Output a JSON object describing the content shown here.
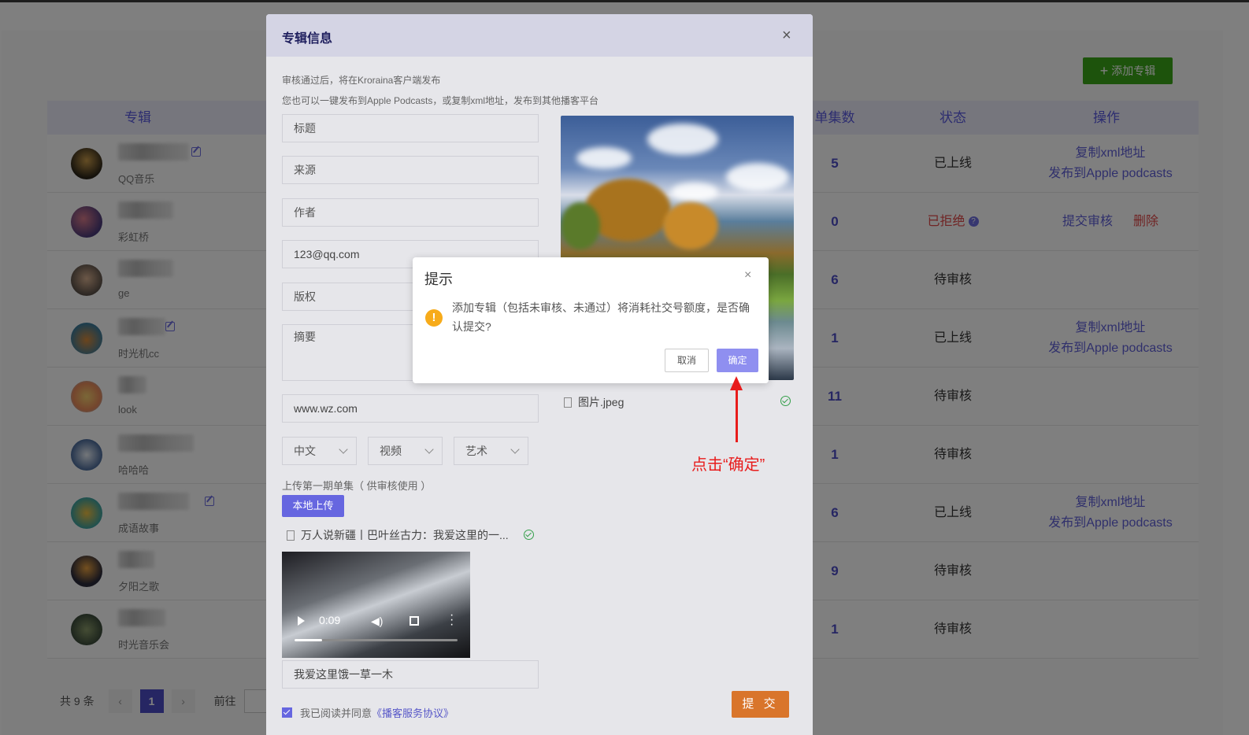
{
  "toolbar": {
    "add_album_label": "添加专辑"
  },
  "table": {
    "headers": {
      "album": "专辑",
      "episodes": "单集数",
      "status": "状态",
      "actions": "操作"
    },
    "rows": [
      {
        "sub": "QQ音乐",
        "count": "5",
        "status": "已上线",
        "ops": [
          "复制xml地址",
          "发布到Apple podcasts"
        ]
      },
      {
        "sub": "彩虹桥",
        "count": "0",
        "status": "已拒绝",
        "ops": [
          "提交审核",
          "删除"
        ]
      },
      {
        "sub": "ge",
        "count": "6",
        "status": "待审核",
        "ops": []
      },
      {
        "sub": "时光机cc",
        "count": "1",
        "status": "已上线",
        "ops": [
          "复制xml地址",
          "发布到Apple podcasts"
        ]
      },
      {
        "sub": "look",
        "count": "11",
        "status": "待审核",
        "ops": []
      },
      {
        "sub": "哈哈哈",
        "count": "1",
        "status": "待审核",
        "ops": []
      },
      {
        "sub": "成语故事",
        "count": "6",
        "status": "已上线",
        "ops": [
          "复制xml地址",
          "发布到Apple podcasts"
        ]
      },
      {
        "sub": "夕阳之歌",
        "count": "9",
        "status": "待审核",
        "ops": []
      },
      {
        "sub": "时光音乐会",
        "count": "1",
        "status": "待审核",
        "ops": []
      }
    ]
  },
  "pager": {
    "total": "共 9 条",
    "prev": "‹",
    "page": "1",
    "next": "›",
    "goto": "前往"
  },
  "album_dialog": {
    "title": "专辑信息",
    "close": "×",
    "note1": "审核通过后，将在Kroraina客户端发布",
    "note2": "您也可以一键发布到Apple Podcasts，或复制xml地址，发布到其他播客平台",
    "fields": {
      "title_placeholder": "标题",
      "source_placeholder": "来源",
      "author_placeholder": "作者",
      "email_value": "123@qq.com",
      "copyright_placeholder": "版权",
      "summary_placeholder": "摘要",
      "website_value": "www.wz.com"
    },
    "selects": {
      "language": "中文",
      "media": "视频",
      "category": "艺术"
    },
    "upload_hint": "上传第一期单集（ 供审核使用 ）",
    "upload_button": "本地上传",
    "episode_file": "万人说新疆丨巴叶丝古力：我爱这里的一...",
    "image_file": "图片.jpeg",
    "video_time": "0:09",
    "video_progress": 0.17,
    "episode_title_value": "我爱这里饿一草一木",
    "agree_text": "我已阅读并同意",
    "agree_link": "《播客服务协议》",
    "submit_label": "提 交"
  },
  "confirm_dialog": {
    "title": "提示",
    "close": "×",
    "icon": "!",
    "message": "添加专辑（包括未审核、未通过）将消耗社交号额度，是否确认提交?",
    "cancel": "取消",
    "ok": "确定"
  },
  "annotation": {
    "text": "点击“确定”"
  }
}
